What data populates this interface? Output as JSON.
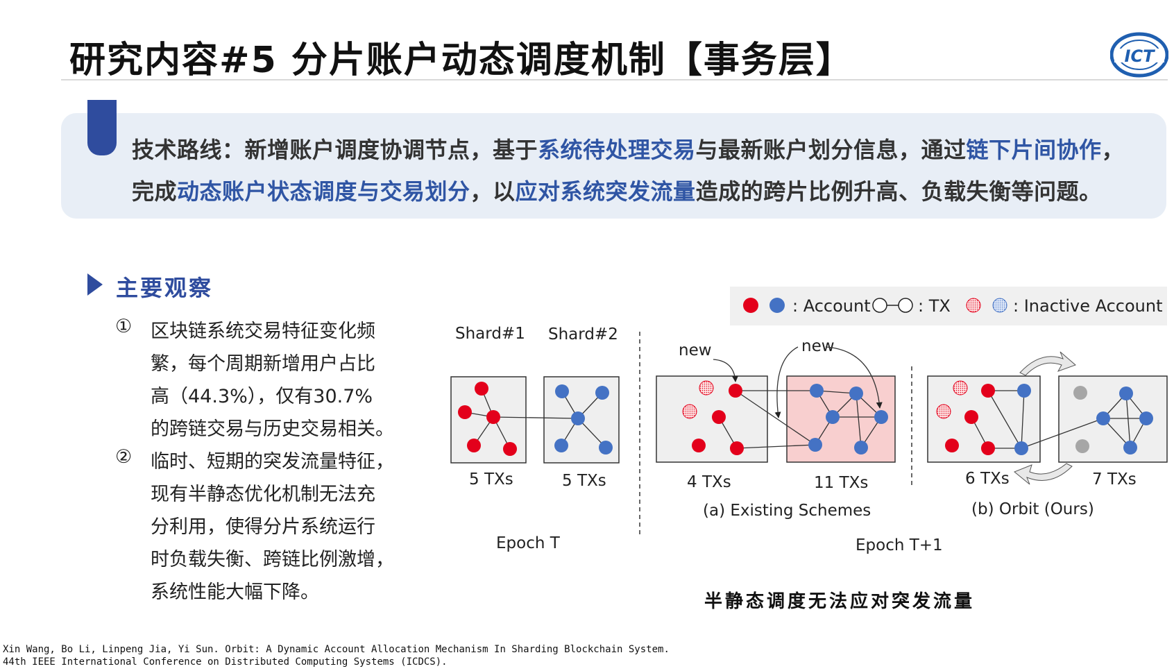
{
  "header": {
    "title": "研究内容#5 分片账户动态调度机制【事务层】",
    "logo_text": "ICT"
  },
  "tech_route": {
    "line1": [
      {
        "text": "技术路线：新增账户调度协调节点，基于",
        "hl": false
      },
      {
        "text": "系统待处理交易",
        "hl": true
      },
      {
        "text": "与最新账户划分信息，通过",
        "hl": false
      },
      {
        "text": "链下片间协作",
        "hl": true
      },
      {
        "text": "，",
        "hl": false
      }
    ],
    "line2": [
      {
        "text": "完成",
        "hl": false
      },
      {
        "text": "动态账户状态调度与交易划分",
        "hl": true
      },
      {
        "text": "，以",
        "hl": false
      },
      {
        "text": "应对系统突发流量",
        "hl": true
      },
      {
        "text": "造成的跨片比例升高、负载失衡等问题。",
        "hl": false
      }
    ]
  },
  "observations": {
    "title": "主要观察",
    "items": [
      {
        "num": "①",
        "lines": [
          "区块链系统交易特征变化频",
          "繁，每个周期新增用户占比",
          "高（44.3%），仅有30.7%",
          "的跨链交易与历史交易相关。"
        ]
      },
      {
        "num": "②",
        "lines": [
          "临时、短期的突发流量特征，",
          "现有半静态优化机制无法充",
          "分利用，使得分片系统运行",
          "时负载失衡、跨链比例激增，",
          "系统性能大幅下降。"
        ]
      }
    ]
  },
  "diagram": {
    "legend": {
      "account": ": Account",
      "tx": ": TX",
      "inactive": ": Inactive Account"
    },
    "shard1_label": "Shard#1",
    "shard2_label": "Shard#2",
    "epoch_t": "Epoch T",
    "epoch_t1": "Epoch T+1",
    "tx_counts": [
      "5 TXs",
      "5 TXs",
      "4 TXs",
      "11 TXs",
      "6 TXs",
      "7 TXs"
    ],
    "new_label": "new",
    "existing": "(a) Existing Schemes",
    "orbit": "(b) Orbit (Ours)",
    "caption": "半静态调度无法应对突发流量",
    "colors": {
      "red": "#e3001b",
      "blue": "#4472c4",
      "box": "#efefef",
      "pink": "#f8cfcf",
      "gray": "#a6a6a6"
    }
  },
  "footer": {
    "line1": "Xin Wang, Bo Li, Linpeng Jia, Yi Sun. Orbit: A Dynamic Account Allocation Mechanism In Sharding Blockchain System.",
    "line2": "44th IEEE International Conference on Distributed Computing Systems (ICDCS)."
  }
}
